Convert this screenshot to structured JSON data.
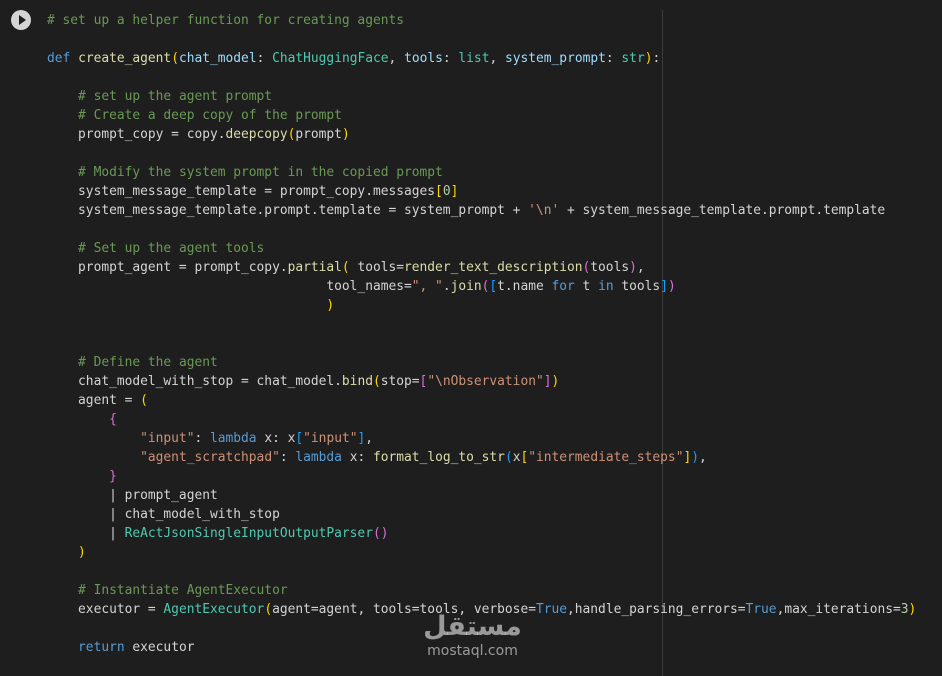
{
  "cell": {
    "run_button_label": "Run cell",
    "code_lines": [
      [
        {
          "t": "# set up a helper function for creating agents",
          "c": "cm"
        }
      ],
      [],
      [
        {
          "t": "def",
          "c": "kw"
        },
        {
          "t": " "
        },
        {
          "t": "create_agent",
          "c": "fn"
        },
        {
          "t": "(",
          "c": "p1"
        },
        {
          "t": "chat_model",
          "c": "pm"
        },
        {
          "t": ": "
        },
        {
          "t": "ChatHuggingFace",
          "c": "ty"
        },
        {
          "t": ", "
        },
        {
          "t": "tools",
          "c": "pm"
        },
        {
          "t": ": "
        },
        {
          "t": "list",
          "c": "ty"
        },
        {
          "t": ", "
        },
        {
          "t": "system_prompt",
          "c": "pm"
        },
        {
          "t": ": "
        },
        {
          "t": "str",
          "c": "ty"
        },
        {
          "t": ")",
          "c": "p1"
        },
        {
          "t": ":"
        }
      ],
      [],
      [
        {
          "t": "    "
        },
        {
          "t": "# set up the agent prompt",
          "c": "cm"
        }
      ],
      [
        {
          "t": "    "
        },
        {
          "t": "# Create a deep copy of the prompt",
          "c": "cm"
        }
      ],
      [
        {
          "t": "    prompt_copy = copy."
        },
        {
          "t": "deepcopy",
          "c": "fn"
        },
        {
          "t": "(",
          "c": "p1"
        },
        {
          "t": "prompt"
        },
        {
          "t": ")",
          "c": "p1"
        }
      ],
      [],
      [
        {
          "t": "    "
        },
        {
          "t": "# Modify the system prompt in the copied prompt",
          "c": "cm"
        }
      ],
      [
        {
          "t": "    system_message_template = prompt_copy.messages"
        },
        {
          "t": "[",
          "c": "p1"
        },
        {
          "t": "0",
          "c": "nm"
        },
        {
          "t": "]",
          "c": "p1"
        }
      ],
      [
        {
          "t": "    system_message_template.prompt.template = system_prompt + "
        },
        {
          "t": "'\\n'",
          "c": "st"
        },
        {
          "t": " + system_message_template.prompt.template"
        }
      ],
      [],
      [
        {
          "t": "    "
        },
        {
          "t": "# Set up the agent tools",
          "c": "cm"
        }
      ],
      [
        {
          "t": "    prompt_agent = prompt_copy."
        },
        {
          "t": "partial",
          "c": "fn"
        },
        {
          "t": "(",
          "c": "p1"
        },
        {
          "t": " tools="
        },
        {
          "t": "render_text_description",
          "c": "fn"
        },
        {
          "t": "(",
          "c": "p2"
        },
        {
          "t": "tools"
        },
        {
          "t": ")",
          "c": "p2"
        },
        {
          "t": ","
        }
      ],
      [
        {
          "t": "                                    tool_names="
        },
        {
          "t": "\", \"",
          "c": "st"
        },
        {
          "t": "."
        },
        {
          "t": "join",
          "c": "fn"
        },
        {
          "t": "(",
          "c": "p2"
        },
        {
          "t": "[",
          "c": "p3"
        },
        {
          "t": "t.name "
        },
        {
          "t": "for",
          "c": "kw"
        },
        {
          "t": " t "
        },
        {
          "t": "in",
          "c": "kw"
        },
        {
          "t": " tools"
        },
        {
          "t": "]",
          "c": "p3"
        },
        {
          "t": ")",
          "c": "p2"
        }
      ],
      [
        {
          "t": "                                    "
        },
        {
          "t": ")",
          "c": "p1"
        }
      ],
      [],
      [],
      [
        {
          "t": "    "
        },
        {
          "t": "# Define the agent",
          "c": "cm"
        }
      ],
      [
        {
          "t": "    chat_model_with_stop = chat_model."
        },
        {
          "t": "bind",
          "c": "fn"
        },
        {
          "t": "(",
          "c": "p1"
        },
        {
          "t": "stop="
        },
        {
          "t": "[",
          "c": "p2"
        },
        {
          "t": "\"\\nObservation\"",
          "c": "st"
        },
        {
          "t": "]",
          "c": "p2"
        },
        {
          "t": ")",
          "c": "p1"
        }
      ],
      [
        {
          "t": "    agent = "
        },
        {
          "t": "(",
          "c": "p1"
        }
      ],
      [
        {
          "t": "        "
        },
        {
          "t": "{",
          "c": "p2"
        }
      ],
      [
        {
          "t": "            "
        },
        {
          "t": "\"input\"",
          "c": "st"
        },
        {
          "t": ": "
        },
        {
          "t": "lambda",
          "c": "kw"
        },
        {
          "t": " x: x"
        },
        {
          "t": "[",
          "c": "p3"
        },
        {
          "t": "\"input\"",
          "c": "st"
        },
        {
          "t": "]",
          "c": "p3"
        },
        {
          "t": ","
        }
      ],
      [
        {
          "t": "            "
        },
        {
          "t": "\"agent_scratchpad\"",
          "c": "st"
        },
        {
          "t": ": "
        },
        {
          "t": "lambda",
          "c": "kw"
        },
        {
          "t": " x: "
        },
        {
          "t": "format_log_to_str",
          "c": "fn"
        },
        {
          "t": "(",
          "c": "p3"
        },
        {
          "t": "x"
        },
        {
          "t": "[",
          "c": "p1"
        },
        {
          "t": "\"intermediate_steps\"",
          "c": "st"
        },
        {
          "t": "]",
          "c": "p1"
        },
        {
          "t": ")",
          "c": "p3"
        },
        {
          "t": ","
        }
      ],
      [
        {
          "t": "        "
        },
        {
          "t": "}",
          "c": "p2"
        }
      ],
      [
        {
          "t": "        | prompt_agent"
        }
      ],
      [
        {
          "t": "        | chat_model_with_stop"
        }
      ],
      [
        {
          "t": "        | "
        },
        {
          "t": "ReActJsonSingleInputOutputParser",
          "c": "ty"
        },
        {
          "t": "(",
          "c": "p2"
        },
        {
          "t": ")",
          "c": "p2"
        }
      ],
      [
        {
          "t": "    "
        },
        {
          "t": ")",
          "c": "p1"
        }
      ],
      [],
      [
        {
          "t": "    "
        },
        {
          "t": "# Instantiate AgentExecutor",
          "c": "cm"
        }
      ],
      [
        {
          "t": "    executor = "
        },
        {
          "t": "AgentExecutor",
          "c": "ty"
        },
        {
          "t": "(",
          "c": "p1"
        },
        {
          "t": "agent=agent, tools=tools, verbose="
        },
        {
          "t": "True",
          "c": "kw"
        },
        {
          "t": ",handle_parsing_errors="
        },
        {
          "t": "True",
          "c": "kw"
        },
        {
          "t": ",max_iterations="
        },
        {
          "t": "3",
          "c": "nm"
        },
        {
          "t": ")",
          "c": "p1"
        }
      ],
      [],
      [
        {
          "t": "    "
        },
        {
          "t": "return",
          "c": "kw"
        },
        {
          "t": " executor"
        }
      ]
    ]
  },
  "watermark": {
    "logo": "مستقل",
    "domain": "mostaql.com"
  }
}
